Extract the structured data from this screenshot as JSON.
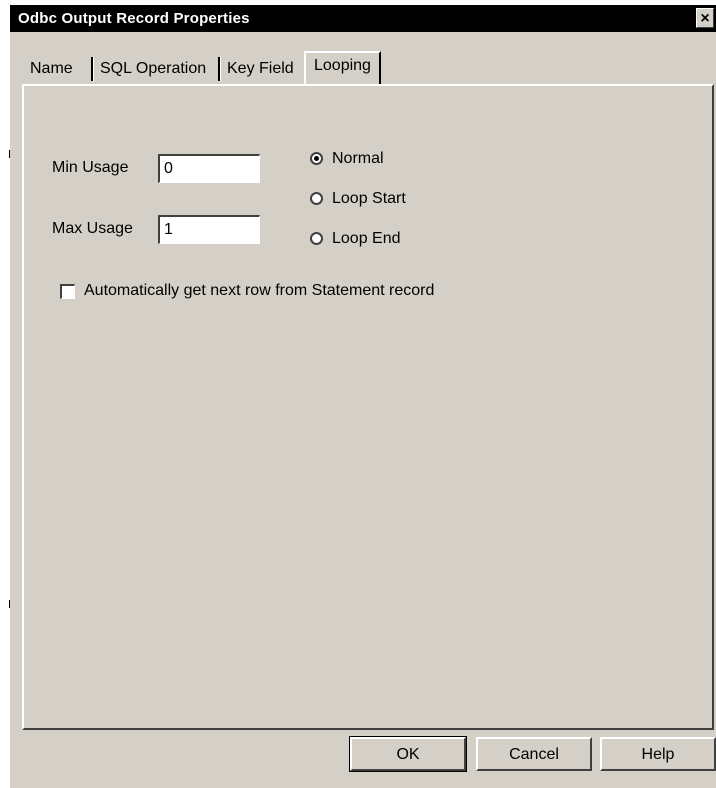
{
  "window": {
    "title": "Odbc Output Record Properties",
    "close_glyph": "×"
  },
  "tabs": [
    {
      "label": "Name"
    },
    {
      "label": "SQL Operation"
    },
    {
      "label": "Key Field"
    },
    {
      "label": "Looping",
      "active": true
    }
  ],
  "form": {
    "min_usage_label": "Min Usage",
    "min_usage_value": "0",
    "max_usage_label": "Max Usage",
    "max_usage_value": "1",
    "radios": [
      {
        "label": "Normal",
        "checked": true
      },
      {
        "label": "Loop Start",
        "checked": false
      },
      {
        "label": "Loop End",
        "checked": false
      }
    ],
    "auto_next_label": "Automatically get next row from Statement record",
    "auto_next_checked": false
  },
  "buttons": {
    "ok": "OK",
    "cancel": "Cancel",
    "help": "Help"
  },
  "colors": {
    "face": "#d4d0c8",
    "titlebar": "#000000"
  }
}
